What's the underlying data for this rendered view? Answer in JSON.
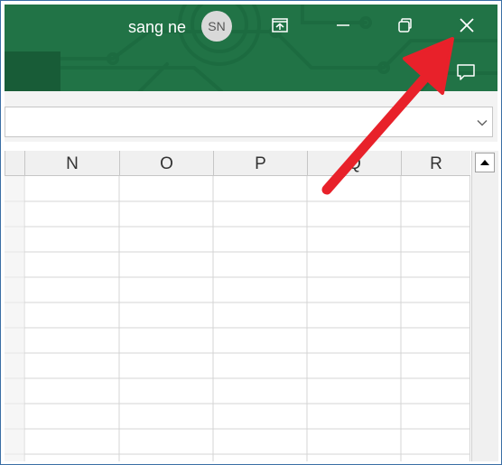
{
  "titlebar": {
    "user_name": "sang ne",
    "avatar_initials": "SN",
    "accent_color": "#217346",
    "controls": [
      {
        "name": "display-options",
        "icon": "display-options-icon"
      },
      {
        "name": "minimize",
        "icon": "minimize-icon"
      },
      {
        "name": "restore",
        "icon": "restore-icon"
      },
      {
        "name": "close",
        "icon": "close-icon"
      }
    ],
    "comments_icon": "comment-icon"
  },
  "formula_bar": {
    "value": "",
    "expand_icon": "chevron-down-icon"
  },
  "sheet": {
    "columns": [
      "N",
      "O",
      "P",
      "Q",
      "R"
    ],
    "visible_rows": 11
  },
  "annotation": {
    "arrow_color": "#e8212a",
    "points_to": "close-button"
  }
}
